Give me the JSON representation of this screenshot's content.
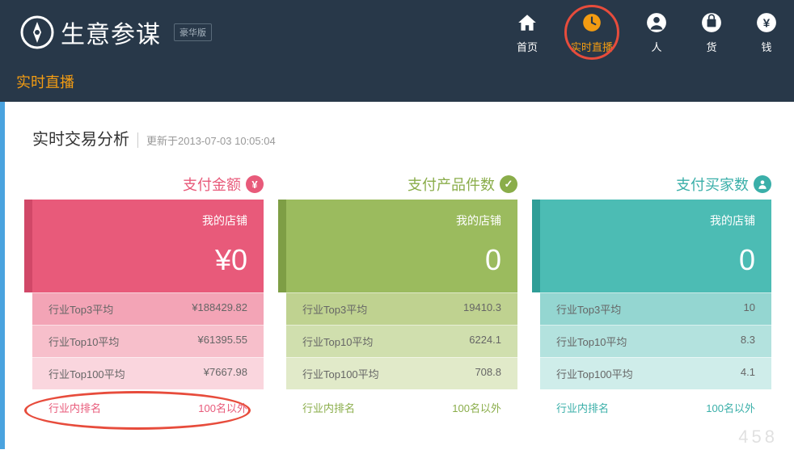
{
  "header": {
    "logo_text": "生意参谋",
    "logo_badge": "豪华版",
    "nav": [
      {
        "label": "首页",
        "icon": "home-icon"
      },
      {
        "label": "实时直播",
        "icon": "clock-icon",
        "active": true
      },
      {
        "label": "人",
        "icon": "person-icon"
      },
      {
        "label": "货",
        "icon": "goods-icon"
      },
      {
        "label": "钱",
        "icon": "money-icon"
      }
    ]
  },
  "sub_title": "实时直播",
  "section": {
    "title": "实时交易分析",
    "meta": "更新于2013-07-03 10:05:04"
  },
  "cards": [
    {
      "label": "支付金额",
      "badge_glyph": "¥",
      "shop_label": "我的店铺",
      "shop_value": "¥0",
      "rows": [
        {
          "k": "行业Top3平均",
          "v": "¥188429.82"
        },
        {
          "k": "行业Top10平均",
          "v": "¥61395.55"
        },
        {
          "k": "行业Top100平均",
          "v": "¥7667.98"
        }
      ],
      "rank_k": "行业内排名",
      "rank_v": "100名以外",
      "highlight_rank": true
    },
    {
      "label": "支付产品件数",
      "badge_glyph": "✓",
      "shop_label": "我的店铺",
      "shop_value": "0",
      "rows": [
        {
          "k": "行业Top3平均",
          "v": "19410.3"
        },
        {
          "k": "行业Top10平均",
          "v": "6224.1"
        },
        {
          "k": "行业Top100平均",
          "v": "708.8"
        }
      ],
      "rank_k": "行业内排名",
      "rank_v": "100名以外"
    },
    {
      "label": "支付买家数",
      "badge_glyph": "●",
      "shop_label": "我的店铺",
      "shop_value": "0",
      "rows": [
        {
          "k": "行业Top3平均",
          "v": "10"
        },
        {
          "k": "行业Top10平均",
          "v": "8.3"
        },
        {
          "k": "行业Top100平均",
          "v": "4.1"
        }
      ],
      "rank_k": "行业内排名",
      "rank_v": "100名以外"
    }
  ],
  "watermark": "458"
}
